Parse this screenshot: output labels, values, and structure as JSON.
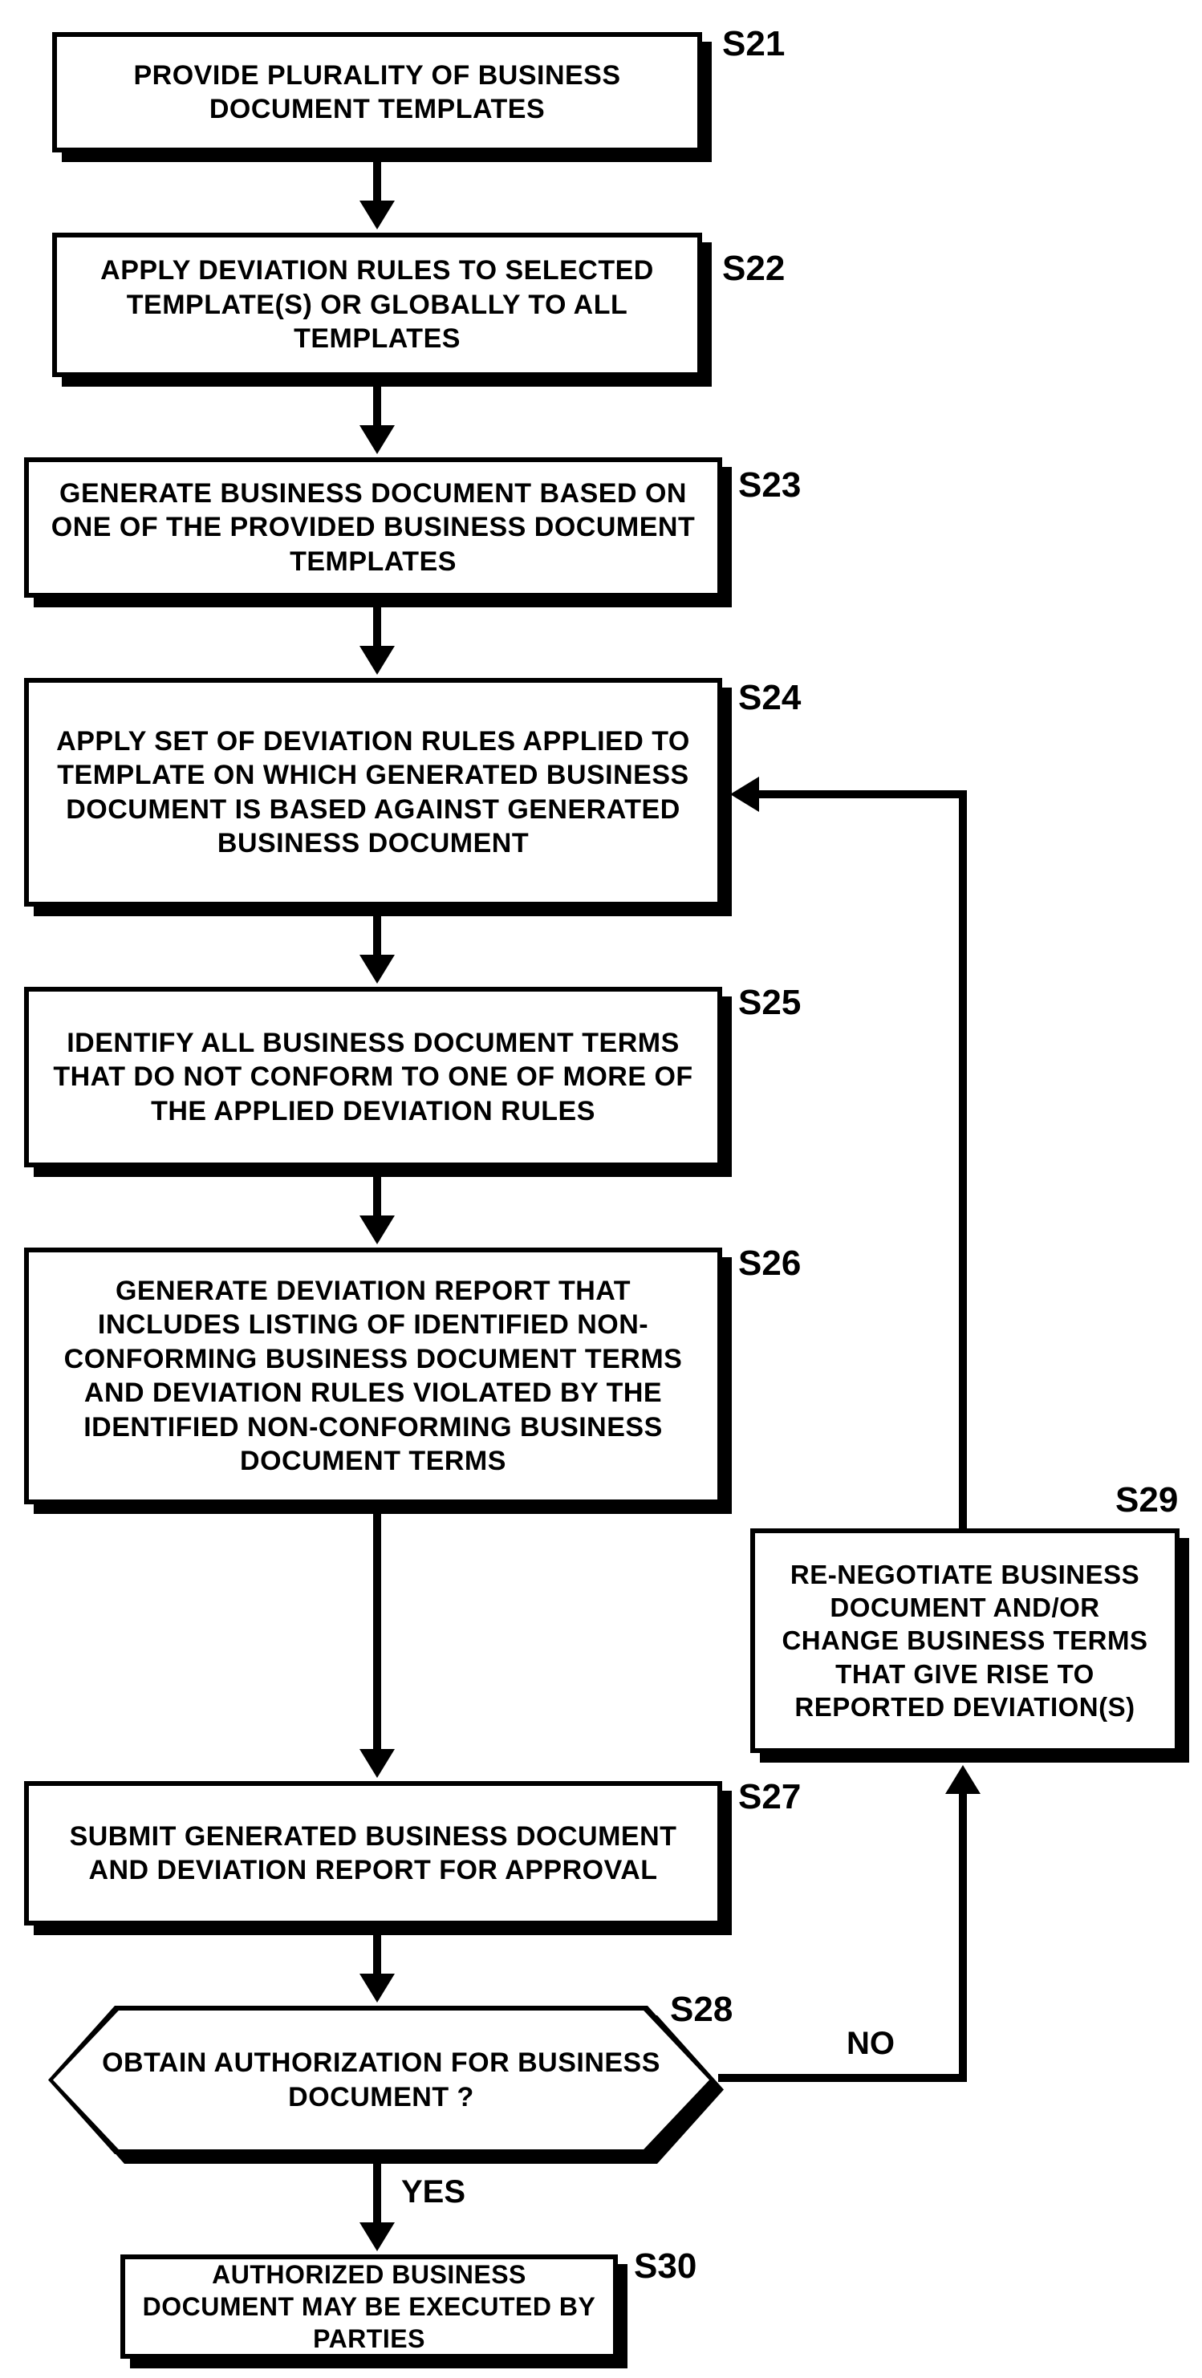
{
  "steps": {
    "s21": {
      "label": "S21",
      "text": "PROVIDE PLURALITY OF BUSINESS DOCUMENT TEMPLATES"
    },
    "s22": {
      "label": "S22",
      "text": "APPLY DEVIATION RULES TO SELECTED TEMPLATE(S) OR GLOBALLY TO ALL TEMPLATES"
    },
    "s23": {
      "label": "S23",
      "text": "GENERATE BUSINESS DOCUMENT BASED ON ONE OF THE PROVIDED BUSINESS DOCUMENT TEMPLATES"
    },
    "s24": {
      "label": "S24",
      "text": "APPLY SET OF DEVIATION RULES APPLIED TO TEMPLATE ON WHICH GENERATED BUSINESS DOCUMENT IS BASED AGAINST GENERATED BUSINESS DOCUMENT"
    },
    "s25": {
      "label": "S25",
      "text": "IDENTIFY ALL BUSINESS DOCUMENT TERMS THAT DO NOT CONFORM TO ONE OF MORE OF THE APPLIED DEVIATION RULES"
    },
    "s26": {
      "label": "S26",
      "text": "GENERATE DEVIATION REPORT THAT INCLUDES LISTING OF IDENTIFIED NON-CONFORMING BUSINESS DOCUMENT TERMS AND DEVIATION RULES VIOLATED BY THE IDENTIFIED NON-CONFORMING BUSINESS DOCUMENT TERMS"
    },
    "s27": {
      "label": "S27",
      "text": "SUBMIT GENERATED BUSINESS DOCUMENT AND DEVIATION REPORT FOR APPROVAL"
    },
    "s28": {
      "label": "S28",
      "text": "OBTAIN AUTHORIZATION FOR BUSINESS DOCUMENT ?"
    },
    "s29": {
      "label": "S29",
      "text": "RE-NEGOTIATE BUSINESS DOCUMENT AND/OR CHANGE BUSINESS TERMS THAT GIVE RISE TO REPORTED DEVIATION(S)"
    },
    "s30": {
      "label": "S30",
      "text": "AUTHORIZED BUSINESS DOCUMENT MAY BE EXECUTED BY PARTIES"
    }
  },
  "edges": {
    "yes": "YES",
    "no": "NO"
  }
}
